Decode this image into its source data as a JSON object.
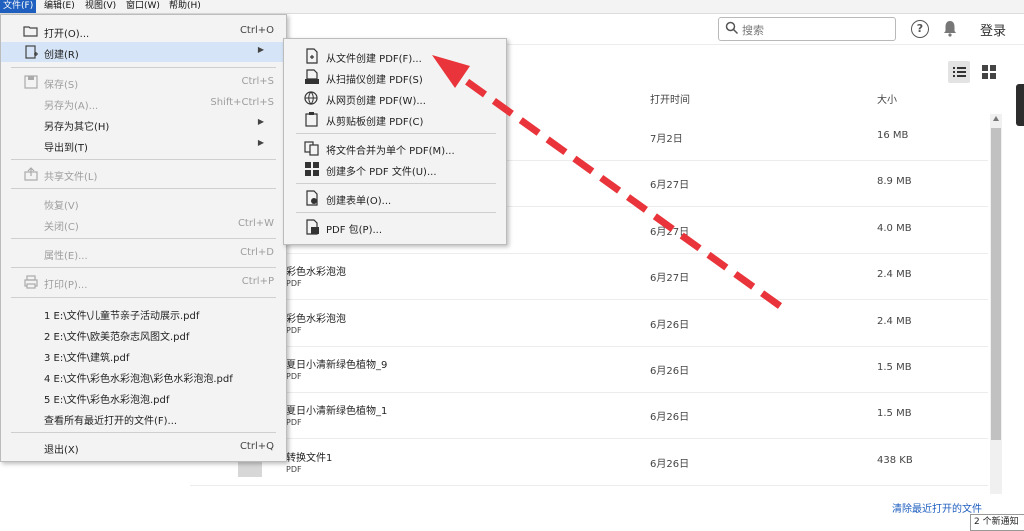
{
  "menubar": {
    "file": "文件(F)",
    "edit": "编辑(E)",
    "view": "视图(V)",
    "window": "窗口(W)",
    "help": "帮助(H)"
  },
  "toolbar": {
    "search_placeholder": "搜索",
    "help_glyph": "?",
    "login": "登录"
  },
  "columns": {
    "opened": "打开时间",
    "size": "大小"
  },
  "rows": [
    {
      "name": "",
      "type": "",
      "date": "7月2日",
      "size": "16 MB"
    },
    {
      "name": "",
      "type": "",
      "date": "6月27日",
      "size": "8.9 MB"
    },
    {
      "name": "",
      "type": "",
      "date": "6月27日",
      "size": "4.0 MB"
    },
    {
      "name": "彩色水彩泡泡",
      "type": "PDF",
      "date": "6月27日",
      "size": "2.4 MB"
    },
    {
      "name": "彩色水彩泡泡",
      "type": "PDF",
      "date": "6月26日",
      "size": "2.4 MB"
    },
    {
      "name": "夏日小清新绿色植物_9",
      "type": "PDF",
      "date": "6月26日",
      "size": "1.5 MB"
    },
    {
      "name": "夏日小清新绿色植物_1",
      "type": "PDF",
      "date": "6月26日",
      "size": "1.5 MB"
    },
    {
      "name": "转换文件1",
      "type": "PDF",
      "date": "6月26日",
      "size": "438 KB"
    }
  ],
  "footer": {
    "clear_recent": "清除最近打开的文件",
    "notice": "2 个新通知"
  },
  "file_menu": {
    "open": {
      "label": "打开(O)...",
      "shortcut": "Ctrl+O"
    },
    "create": {
      "label": "创建(R)",
      "arrow": "▶"
    },
    "save": {
      "label": "保存(S)",
      "shortcut": "Ctrl+S"
    },
    "save_as": {
      "label": "另存为(A)...",
      "shortcut": "Shift+Ctrl+S"
    },
    "save_as_other": {
      "label": "另存为其它(H)",
      "arrow": "▶"
    },
    "export_to": {
      "label": "导出到(T)",
      "arrow": "▶"
    },
    "share": {
      "label": "共享文件(L)"
    },
    "revert": {
      "label": "恢复(V)"
    },
    "close": {
      "label": "关闭(C)",
      "shortcut": "Ctrl+W"
    },
    "properties": {
      "label": "属性(E)...",
      "shortcut": "Ctrl+D"
    },
    "print": {
      "label": "打印(P)...",
      "shortcut": "Ctrl+P"
    },
    "recent": [
      "1 E:\\文件\\儿童节亲子活动展示.pdf",
      "2 E:\\文件\\欧美范杂志风图文.pdf",
      "3 E:\\文件\\建筑.pdf",
      "4 E:\\文件\\彩色水彩泡泡\\彩色水彩泡泡.pdf",
      "5 E:\\文件\\彩色水彩泡泡.pdf"
    ],
    "view_all_recent": "查看所有最近打开的文件(F)...",
    "exit": {
      "label": "退出(X)",
      "shortcut": "Ctrl+Q"
    }
  },
  "create_submenu": {
    "from_file": "从文件创建 PDF(F)...",
    "from_scanner": "从扫描仪创建 PDF(S)",
    "from_web": "从网页创建 PDF(W)...",
    "from_clipboard": "从剪贴板创建 PDF(C)",
    "combine": "将文件合并为单个 PDF(M)...",
    "create_multiple": "创建多个 PDF 文件(U)...",
    "create_form": "创建表单(O)...",
    "pdf_portfolio": "PDF 包(P)..."
  },
  "colors": {
    "accent": "#1f5fbf",
    "annotation_arrow": "#e8343a"
  }
}
